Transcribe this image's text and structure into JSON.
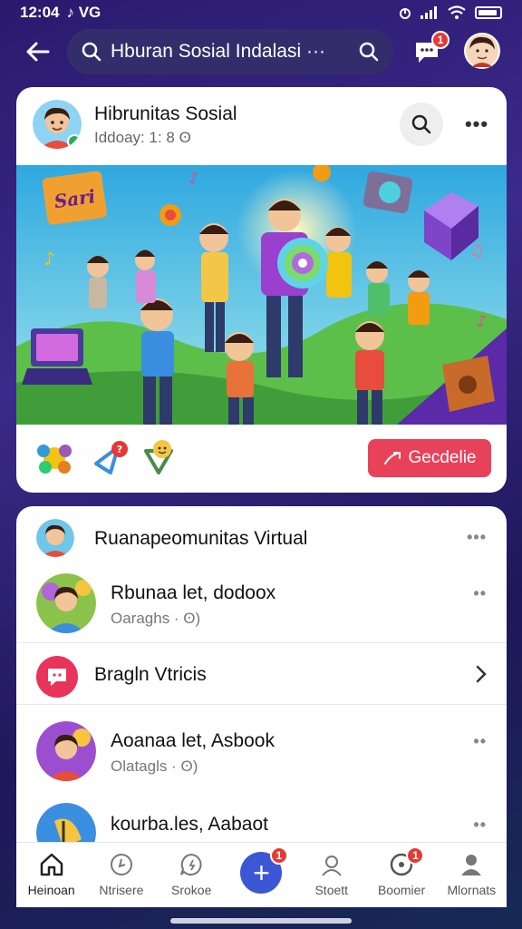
{
  "status": {
    "time": "12:04",
    "extra": "♪ VG"
  },
  "search": {
    "value": "Hburan Sosial Indalasi ···"
  },
  "notifications": {
    "badge": "1"
  },
  "post": {
    "author": "Hibrunitas Sosial",
    "subtitle": "Iddoay: 1: 8 ʘ",
    "banner_sign": "Sari",
    "cta_label": "Gecdelie"
  },
  "feed": {
    "header": {
      "name": "Ruanapeomunitas Virtual"
    },
    "items": [
      {
        "name": "Rbunaa let, dodoox",
        "meta": "Oaraghs · ʘ)"
      },
      {
        "name": "Bragln Vtricis"
      },
      {
        "name": "Aoanaa let, Asbook",
        "meta": "Olatagls · ʘ)"
      },
      {
        "name": "kourba.les, Aabaot"
      }
    ]
  },
  "nav": {
    "items": [
      {
        "label": "Heinoan"
      },
      {
        "label": "Ntrisere"
      },
      {
        "label": "Srokoe"
      },
      {
        "label": "+",
        "badge": "1"
      },
      {
        "label": "Stoett"
      },
      {
        "label": "Boomier",
        "badge": "1"
      },
      {
        "label": "Mlornats"
      }
    ]
  },
  "colors": {
    "accent": "#3b57d6",
    "cta": "#e8425a",
    "badge": "#e53935",
    "background": "#2a1a6e"
  }
}
